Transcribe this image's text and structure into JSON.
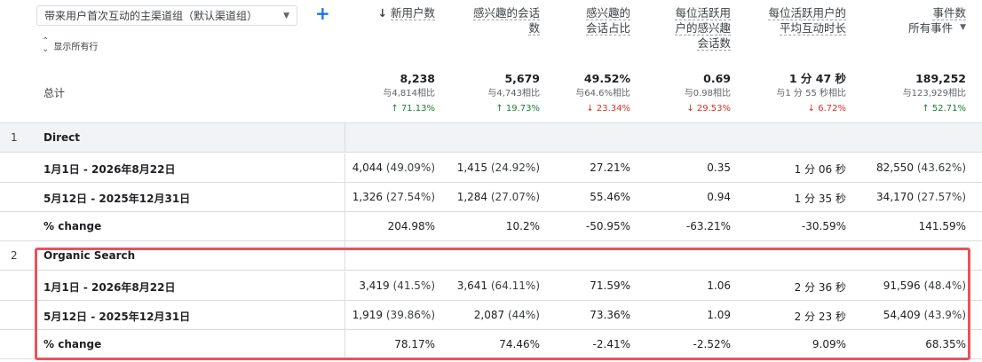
{
  "dimension": {
    "label": "带来用户首次互动的主渠道组（默认渠道组）",
    "add_label": "+"
  },
  "show_all_rows": "显示所有行",
  "total_label": "总计",
  "columns": [
    {
      "title": "新用户数",
      "sorted": true,
      "arrow": "↓"
    },
    {
      "title": "感兴趣的会话数"
    },
    {
      "title": "感兴趣的会话占比"
    },
    {
      "title": "每位活跃用户的感兴趣会话数"
    },
    {
      "title": "每位活跃用户的平均互动时长"
    },
    {
      "title": "事件数",
      "subtitle": "所有事件"
    }
  ],
  "totals": [
    {
      "value": "8,238",
      "compare": "与4,814相比",
      "change": "↑ 71.13%",
      "dir": "up"
    },
    {
      "value": "5,679",
      "compare": "与4,743相比",
      "change": "↑ 19.73%",
      "dir": "up"
    },
    {
      "value": "49.52%",
      "compare": "与64.6%相比",
      "change": "↓ 23.34%",
      "dir": "down"
    },
    {
      "value": "0.69",
      "compare": "与0.98相比",
      "change": "↓ 29.53%",
      "dir": "down"
    },
    {
      "value": "1 分 47 秒",
      "compare": "与1 分 55 秒相比",
      "change": "↓ 6.72%",
      "dir": "down"
    },
    {
      "value": "189,252",
      "compare": "与123,929相比",
      "change": "↑ 52.71%",
      "dir": "up"
    }
  ],
  "rows": [
    {
      "type": "group",
      "num": "1",
      "label": "Direct"
    },
    {
      "type": "data",
      "label": "1月1日 - 2026年8月22日",
      "cells": [
        {
          "v": "4,044",
          "p": "(49.09%)"
        },
        {
          "v": "1,415",
          "p": "(24.92%)"
        },
        {
          "v": "27.21%"
        },
        {
          "v": "0.35"
        },
        {
          "v": "1 分 06 秒"
        },
        {
          "v": "82,550",
          "p": "(43.62%)"
        }
      ]
    },
    {
      "type": "data",
      "label": "5月12日 - 2025年12月31日",
      "cells": [
        {
          "v": "1,326",
          "p": "(27.54%)"
        },
        {
          "v": "1,284",
          "p": "(27.07%)"
        },
        {
          "v": "55.46%"
        },
        {
          "v": "0.94"
        },
        {
          "v": "1 分 35 秒"
        },
        {
          "v": "34,170",
          "p": "(27.57%)"
        }
      ]
    },
    {
      "type": "data",
      "label": "% change",
      "cells": [
        {
          "v": "204.98%"
        },
        {
          "v": "10.2%"
        },
        {
          "v": "-50.95%"
        },
        {
          "v": "-63.21%"
        },
        {
          "v": "-30.59%"
        },
        {
          "v": "141.59%"
        }
      ]
    },
    {
      "type": "group2",
      "num": "2",
      "label": "Organic Search"
    },
    {
      "type": "data",
      "label": "1月1日 - 2026年8月22日",
      "cells": [
        {
          "v": "3,419",
          "p": "(41.5%)"
        },
        {
          "v": "3,641",
          "p": "(64.11%)"
        },
        {
          "v": "71.59%"
        },
        {
          "v": "1.06"
        },
        {
          "v": "2 分 36 秒"
        },
        {
          "v": "91,596",
          "p": "(48.4%)"
        }
      ]
    },
    {
      "type": "data",
      "label": "5月12日 - 2025年12月31日",
      "cells": [
        {
          "v": "1,919",
          "p": "(39.86%)"
        },
        {
          "v": "2,087",
          "p": "(44%)"
        },
        {
          "v": "73.36%"
        },
        {
          "v": "1.09"
        },
        {
          "v": "2 分 23 秒"
        },
        {
          "v": "54,409",
          "p": "(43.9%)"
        }
      ]
    },
    {
      "type": "data",
      "label": "% change",
      "cells": [
        {
          "v": "78.17%"
        },
        {
          "v": "74.46%"
        },
        {
          "v": "-2.41%"
        },
        {
          "v": "-2.52%"
        },
        {
          "v": "9.09%"
        },
        {
          "v": "68.35%"
        }
      ]
    }
  ],
  "colors": {
    "up": "#188038",
    "down": "#d93025",
    "highlight": "#e8535a",
    "accent": "#1a73e8"
  }
}
